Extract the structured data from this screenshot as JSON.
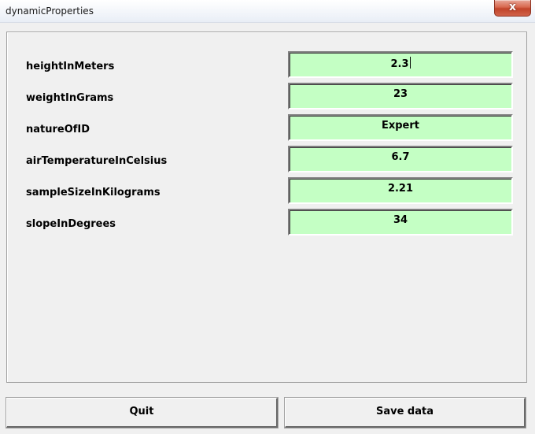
{
  "window": {
    "title": "dynamicProperties",
    "close_glyph": "x",
    "close_icon": "close-icon"
  },
  "properties": [
    {
      "label": "heightInMeters",
      "value": "2.3"
    },
    {
      "label": "weightInGrams",
      "value": "23"
    },
    {
      "label": "natureOfID",
      "value": "Expert"
    },
    {
      "label": "airTemperatureInCelsius",
      "value": "6.7"
    },
    {
      "label": "sampleSizeInKilograms",
      "value": "2.21"
    },
    {
      "label": "slopeInDegrees",
      "value": "34"
    }
  ],
  "buttons": {
    "quit_label": "Quit",
    "save_label": "Save data"
  },
  "colors": {
    "field_background": "#c4ffc4",
    "close_button": "#c8503a"
  }
}
